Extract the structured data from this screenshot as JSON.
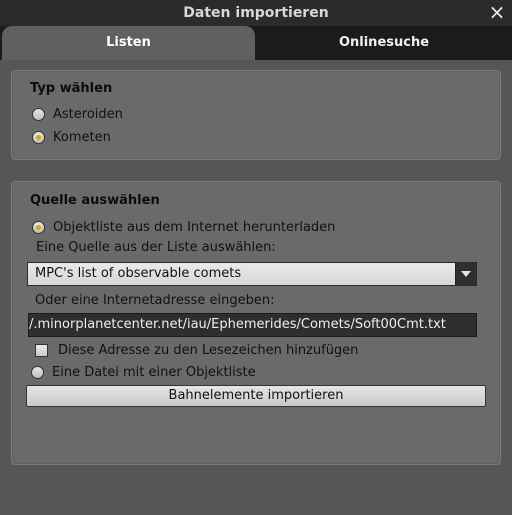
{
  "window": {
    "title": "Daten importieren",
    "close_icon": "×"
  },
  "tabs": [
    {
      "label": "Listen",
      "active": true
    },
    {
      "label": "Onlinesuche",
      "active": false
    }
  ],
  "type_group": {
    "title": "Typ wählen",
    "options": [
      {
        "label": "Asteroiden",
        "checked": false
      },
      {
        "label": "Kometen",
        "checked": true
      }
    ]
  },
  "source_group": {
    "title": "Quelle auswählen",
    "option_internet": {
      "label": "Objektliste aus dem Internet herunterladen",
      "checked": true
    },
    "select_prompt": "Eine Quelle aus der Liste auswählen:",
    "selected_source": "MPC's list of observable comets",
    "url_prompt": "Oder eine Internetadresse eingeben:",
    "url_value": "/.minorplanetcenter.net/iau/Ephemerides/Comets/Soft00Cmt.txt",
    "bookmark_label": "Diese Adresse zu den Lesezeichen hinzufügen",
    "bookmark_checked": false,
    "option_file": {
      "label": "Eine Datei mit einer Objektliste",
      "checked": false
    },
    "import_button": "Bahnelemente importieren"
  },
  "colors": {
    "accent": "#d9a810",
    "panel": "#565656",
    "group": "#6a6a6a"
  }
}
